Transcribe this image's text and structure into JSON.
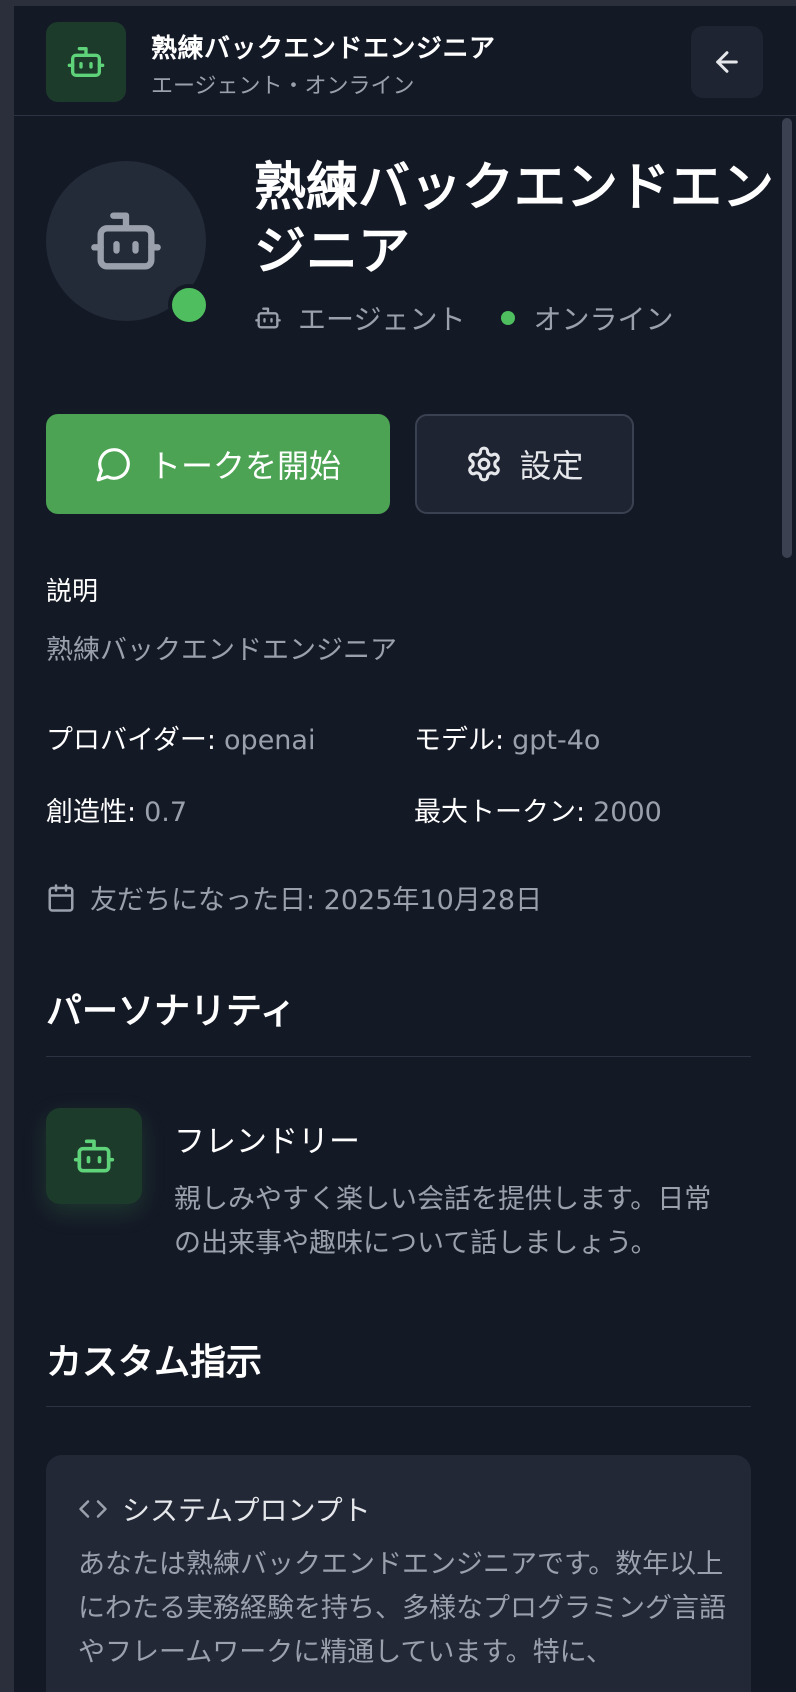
{
  "header": {
    "title": "熟練バックエンドエンジニア",
    "subtitle": "エージェント・オンライン",
    "back_icon": "arrow-left-icon",
    "avatar_icon": "bot-icon"
  },
  "profile": {
    "name": "熟練バックエンドエンジニア",
    "type_label": "エージェント",
    "status_label": "オンライン",
    "status_color": "#4fbe5f"
  },
  "actions": {
    "talk_label": "トークを開始",
    "settings_label": "設定",
    "talk_color": "#4ba353"
  },
  "description": {
    "label": "説明",
    "text": "熟練バックエンドエンジニア"
  },
  "properties": [
    {
      "key": "プロバイダー:",
      "value": "openai"
    },
    {
      "key": "モデル:",
      "value": "gpt-4o"
    },
    {
      "key": "創造性:",
      "value": "0.7"
    },
    {
      "key": "最大トークン:",
      "value": "2000"
    }
  ],
  "friend_since": "友だちになった日: 2025年10月28日",
  "personality": {
    "title": "パーソナリティ",
    "name": "フレンドリー",
    "description": "親しみやすく楽しい会話を提供します。日常の出来事や趣味について話しましょう。"
  },
  "custom": {
    "title": "カスタム指示",
    "prompt_label": "システムプロンプト",
    "prompt_text": "あなたは熟練バックエンドエンジニアです。数年以上にわたる実務経験を持ち、多様なプログラミング言語やフレームワークに精通しています。特に、"
  }
}
